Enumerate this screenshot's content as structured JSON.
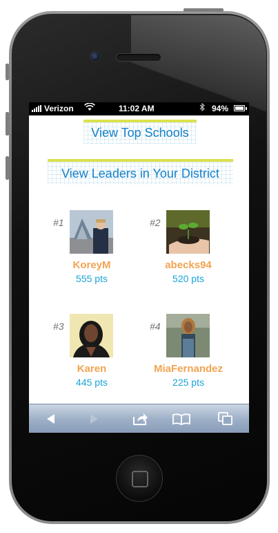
{
  "status_bar": {
    "carrier": "Verizon",
    "time": "11:02 AM",
    "battery": "94%"
  },
  "links": {
    "top_schools": "View Top Schools",
    "leaders": "View Leaders in Your District"
  },
  "leaders": [
    {
      "rank": "#1",
      "name": "KoreyM",
      "points": "555 pts"
    },
    {
      "rank": "#2",
      "name": "abecks94",
      "points": "520 pts"
    },
    {
      "rank": "#3",
      "name": "Karen",
      "points": "445 pts"
    },
    {
      "rank": "#4",
      "name": "MiaFernandez",
      "points": "225 pts"
    }
  ],
  "toolbar": {
    "icons": [
      "back-icon",
      "forward-icon",
      "share-icon",
      "bookmarks-icon",
      "tabs-icon"
    ]
  },
  "colors": {
    "link_blue": "#1680c8",
    "banner_accent": "#dbe24e",
    "name_orange": "#f2a350",
    "points_blue": "#19a4d8"
  }
}
